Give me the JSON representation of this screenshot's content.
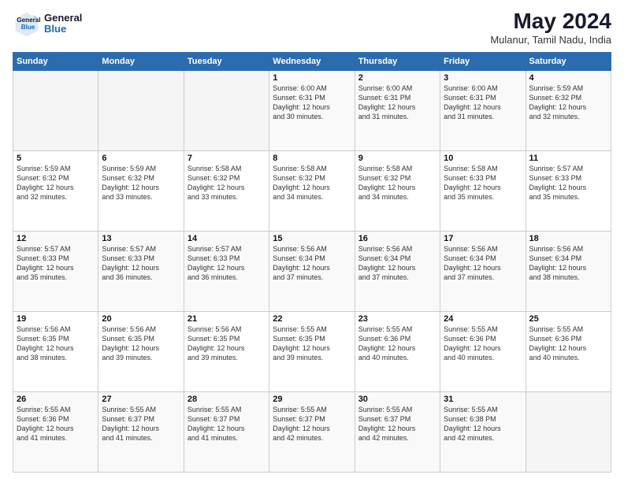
{
  "header": {
    "logo_general": "General",
    "logo_blue": "Blue",
    "title": "May 2024",
    "subtitle": "Mulanur, Tamil Nadu, India"
  },
  "weekdays": [
    "Sunday",
    "Monday",
    "Tuesday",
    "Wednesday",
    "Thursday",
    "Friday",
    "Saturday"
  ],
  "weeks": [
    [
      {
        "day": "",
        "info": ""
      },
      {
        "day": "",
        "info": ""
      },
      {
        "day": "",
        "info": ""
      },
      {
        "day": "1",
        "info": "Sunrise: 6:00 AM\nSunset: 6:31 PM\nDaylight: 12 hours\nand 30 minutes."
      },
      {
        "day": "2",
        "info": "Sunrise: 6:00 AM\nSunset: 6:31 PM\nDaylight: 12 hours\nand 31 minutes."
      },
      {
        "day": "3",
        "info": "Sunrise: 6:00 AM\nSunset: 6:31 PM\nDaylight: 12 hours\nand 31 minutes."
      },
      {
        "day": "4",
        "info": "Sunrise: 5:59 AM\nSunset: 6:32 PM\nDaylight: 12 hours\nand 32 minutes."
      }
    ],
    [
      {
        "day": "5",
        "info": "Sunrise: 5:59 AM\nSunset: 6:32 PM\nDaylight: 12 hours\nand 32 minutes."
      },
      {
        "day": "6",
        "info": "Sunrise: 5:59 AM\nSunset: 6:32 PM\nDaylight: 12 hours\nand 33 minutes."
      },
      {
        "day": "7",
        "info": "Sunrise: 5:58 AM\nSunset: 6:32 PM\nDaylight: 12 hours\nand 33 minutes."
      },
      {
        "day": "8",
        "info": "Sunrise: 5:58 AM\nSunset: 6:32 PM\nDaylight: 12 hours\nand 34 minutes."
      },
      {
        "day": "9",
        "info": "Sunrise: 5:58 AM\nSunset: 6:32 PM\nDaylight: 12 hours\nand 34 minutes."
      },
      {
        "day": "10",
        "info": "Sunrise: 5:58 AM\nSunset: 6:33 PM\nDaylight: 12 hours\nand 35 minutes."
      },
      {
        "day": "11",
        "info": "Sunrise: 5:57 AM\nSunset: 6:33 PM\nDaylight: 12 hours\nand 35 minutes."
      }
    ],
    [
      {
        "day": "12",
        "info": "Sunrise: 5:57 AM\nSunset: 6:33 PM\nDaylight: 12 hours\nand 35 minutes."
      },
      {
        "day": "13",
        "info": "Sunrise: 5:57 AM\nSunset: 6:33 PM\nDaylight: 12 hours\nand 36 minutes."
      },
      {
        "day": "14",
        "info": "Sunrise: 5:57 AM\nSunset: 6:33 PM\nDaylight: 12 hours\nand 36 minutes."
      },
      {
        "day": "15",
        "info": "Sunrise: 5:56 AM\nSunset: 6:34 PM\nDaylight: 12 hours\nand 37 minutes."
      },
      {
        "day": "16",
        "info": "Sunrise: 5:56 AM\nSunset: 6:34 PM\nDaylight: 12 hours\nand 37 minutes."
      },
      {
        "day": "17",
        "info": "Sunrise: 5:56 AM\nSunset: 6:34 PM\nDaylight: 12 hours\nand 37 minutes."
      },
      {
        "day": "18",
        "info": "Sunrise: 5:56 AM\nSunset: 6:34 PM\nDaylight: 12 hours\nand 38 minutes."
      }
    ],
    [
      {
        "day": "19",
        "info": "Sunrise: 5:56 AM\nSunset: 6:35 PM\nDaylight: 12 hours\nand 38 minutes."
      },
      {
        "day": "20",
        "info": "Sunrise: 5:56 AM\nSunset: 6:35 PM\nDaylight: 12 hours\nand 39 minutes."
      },
      {
        "day": "21",
        "info": "Sunrise: 5:56 AM\nSunset: 6:35 PM\nDaylight: 12 hours\nand 39 minutes."
      },
      {
        "day": "22",
        "info": "Sunrise: 5:55 AM\nSunset: 6:35 PM\nDaylight: 12 hours\nand 39 minutes."
      },
      {
        "day": "23",
        "info": "Sunrise: 5:55 AM\nSunset: 6:36 PM\nDaylight: 12 hours\nand 40 minutes."
      },
      {
        "day": "24",
        "info": "Sunrise: 5:55 AM\nSunset: 6:36 PM\nDaylight: 12 hours\nand 40 minutes."
      },
      {
        "day": "25",
        "info": "Sunrise: 5:55 AM\nSunset: 6:36 PM\nDaylight: 12 hours\nand 40 minutes."
      }
    ],
    [
      {
        "day": "26",
        "info": "Sunrise: 5:55 AM\nSunset: 6:36 PM\nDaylight: 12 hours\nand 41 minutes."
      },
      {
        "day": "27",
        "info": "Sunrise: 5:55 AM\nSunset: 6:37 PM\nDaylight: 12 hours\nand 41 minutes."
      },
      {
        "day": "28",
        "info": "Sunrise: 5:55 AM\nSunset: 6:37 PM\nDaylight: 12 hours\nand 41 minutes."
      },
      {
        "day": "29",
        "info": "Sunrise: 5:55 AM\nSunset: 6:37 PM\nDaylight: 12 hours\nand 42 minutes."
      },
      {
        "day": "30",
        "info": "Sunrise: 5:55 AM\nSunset: 6:37 PM\nDaylight: 12 hours\nand 42 minutes."
      },
      {
        "day": "31",
        "info": "Sunrise: 5:55 AM\nSunset: 6:38 PM\nDaylight: 12 hours\nand 42 minutes."
      },
      {
        "day": "",
        "info": ""
      }
    ]
  ]
}
